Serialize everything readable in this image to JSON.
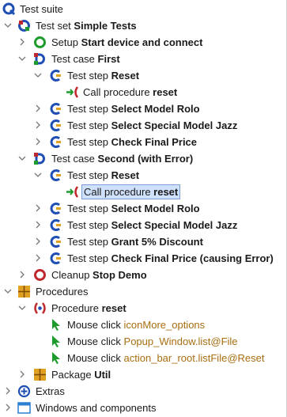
{
  "tree": {
    "root": {
      "label": "Test suite"
    },
    "testset": {
      "prefix": "Test set ",
      "name": "Simple Tests"
    },
    "setup": {
      "prefix": "Setup  ",
      "name": "Start device and connect"
    },
    "case_first": {
      "prefix": "Test case ",
      "name": "First"
    },
    "step_reset_1": {
      "prefix": "Test step ",
      "name": "Reset"
    },
    "call_1": {
      "prefix": "Call procedure ",
      "name": "reset"
    },
    "step_model_rolo_1": {
      "prefix": "Test step ",
      "name": "Select Model Rolo"
    },
    "step_jazz_1": {
      "prefix": "Test step ",
      "name": "Select Special Model Jazz"
    },
    "step_price_1": {
      "prefix": "Test step ",
      "name": "Check Final Price"
    },
    "case_second": {
      "prefix": "Test case ",
      "name": "Second (with Error)"
    },
    "step_reset_2": {
      "prefix": "Test step ",
      "name": "Reset"
    },
    "call_2": {
      "prefix": "Call procedure ",
      "name": "reset"
    },
    "step_model_rolo_2": {
      "prefix": "Test step ",
      "name": "Select Model Rolo"
    },
    "step_jazz_2": {
      "prefix": "Test step ",
      "name": "Select Special Model Jazz"
    },
    "step_discount": {
      "prefix": "Test step ",
      "name": "Grant 5% Discount"
    },
    "step_price_2": {
      "prefix": "Test step ",
      "name": "Check Final Price (causing Error)"
    },
    "cleanup": {
      "prefix": "Cleanup ",
      "name": "Stop Demo"
    },
    "procedures": {
      "label": "Procedures"
    },
    "proc_reset": {
      "prefix": "Procedure ",
      "name": "reset"
    },
    "click_1": {
      "prefix": "Mouse click ",
      "target": "iconMore_options"
    },
    "click_2": {
      "prefix": "Mouse click ",
      "target": "Popup_Window.list@File"
    },
    "click_3": {
      "prefix": "Mouse click ",
      "target": "action_bar_root.listFile@Reset"
    },
    "package": {
      "prefix": "Package ",
      "name": "Util"
    },
    "extras": {
      "label": "Extras"
    },
    "windows": {
      "label": "Windows and components"
    }
  },
  "colors": {
    "qfs_blue": "#1f4fb4",
    "green": "#1e9b2d",
    "red": "#c0282d",
    "orange_text": "#a86e10",
    "selection": "#cfe0fb"
  },
  "icons": {
    "root": "testsuite-icon",
    "testset": "testset-icon",
    "setup": "setup-icon",
    "testcase": "testcase-icon",
    "teststep": "teststep-icon",
    "call": "procedure-call-icon",
    "cleanup": "cleanup-icon",
    "procedures": "procedures-folder-icon",
    "procedure": "procedure-icon",
    "mouseclick": "mouse-click-icon",
    "package": "package-icon",
    "extras": "extras-icon",
    "windows": "windows-components-icon"
  }
}
